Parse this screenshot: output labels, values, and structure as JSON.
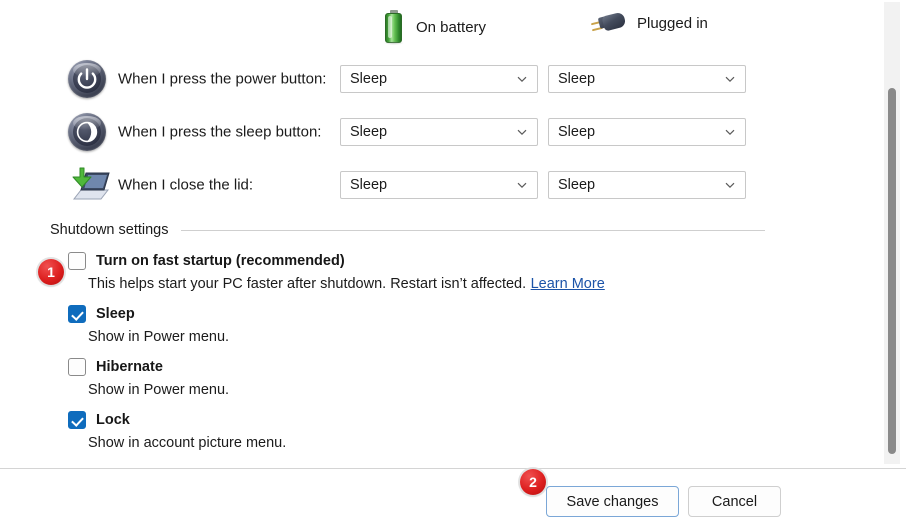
{
  "columns": [
    {
      "icon": "battery-icon",
      "label": "On battery"
    },
    {
      "icon": "power-plug-icon",
      "label": "Plugged in"
    }
  ],
  "settings_rows": [
    {
      "icon": "power-button-icon",
      "label": "When I press the power button:",
      "on_battery": "Sleep",
      "plugged_in": "Sleep"
    },
    {
      "icon": "sleep-button-icon",
      "label": "When I press the sleep button:",
      "on_battery": "Sleep",
      "plugged_in": "Sleep"
    },
    {
      "icon": "laptop-lid-icon",
      "label": "When I close the lid:",
      "on_battery": "Sleep",
      "plugged_in": "Sleep"
    }
  ],
  "shutdown_settings": {
    "title": "Shutdown settings",
    "options": [
      {
        "label": "Turn on fast startup (recommended)",
        "checked": false,
        "description": "This helps start your PC faster after shutdown. Restart isn’t affected.",
        "link": "Learn More"
      },
      {
        "label": "Sleep",
        "checked": true,
        "description": "Show in Power menu.",
        "link": ""
      },
      {
        "label": "Hibernate",
        "checked": false,
        "description": "Show in Power menu.",
        "link": ""
      },
      {
        "label": "Lock",
        "checked": true,
        "description": "Show in account picture menu.",
        "link": ""
      }
    ]
  },
  "footer": {
    "save_label": "Save changes",
    "cancel_label": "Cancel"
  },
  "annotations": [
    {
      "number": "1"
    },
    {
      "number": "2"
    }
  ],
  "colors": {
    "accent_checkbox": "#0f6cbd",
    "link": "#1b53a8",
    "badge_red": "#dd1f1f",
    "save_border": "#7ba7d7",
    "scroll_thumb": "#8a8a8a"
  }
}
